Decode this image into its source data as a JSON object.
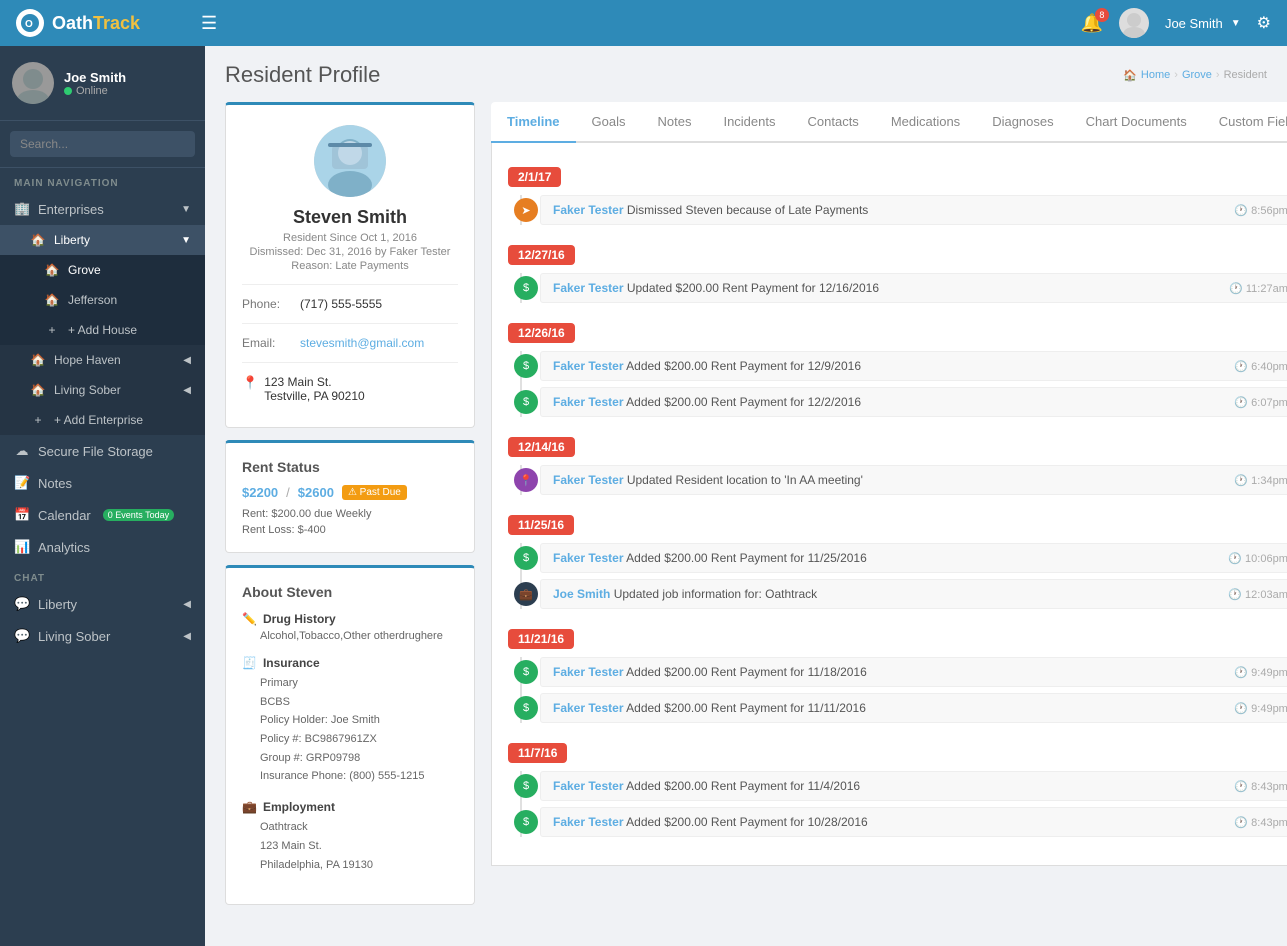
{
  "app": {
    "name": "OathTrack",
    "logo_text_1": "Oath",
    "logo_text_2": "Track"
  },
  "topnav": {
    "hamburger": "☰",
    "bell_count": "8",
    "user_name": "Joe Smith",
    "connect_icon": "⚙"
  },
  "sidebar": {
    "user": {
      "name": "Joe Smith",
      "status": "Online"
    },
    "search_placeholder": "Search...",
    "nav_label": "MAIN NAVIGATION",
    "enterprises_label": "Enterprises",
    "liberty_label": "Liberty",
    "grove_label": "Grove",
    "jefferson_label": "Jefferson",
    "add_house_label": "+ Add House",
    "hope_haven_label": "Hope Haven",
    "living_sober_label": "Living Sober",
    "add_enterprise_label": "+ Add Enterprise",
    "secure_file_storage_label": "Secure File Storage",
    "notes_label": "Notes",
    "calendar_label": "Calendar",
    "calendar_badge": "0 Events Today",
    "analytics_label": "Analytics",
    "chat_label": "Chat",
    "chat_liberty_label": "Liberty",
    "chat_living_sober_label": "Living Sober"
  },
  "page": {
    "title": "Resident Profile",
    "breadcrumb": {
      "home": "Home",
      "enterprise": "Grove",
      "current": "Resident"
    }
  },
  "profile": {
    "name": "Steven Smith",
    "resident_since": "Resident Since Oct 1, 2016",
    "dismissed": "Dismissed: Dec 31, 2016 by Faker Tester",
    "reason": "Reason: Late Payments",
    "phone_label": "Phone:",
    "phone": "(717) 555-5555",
    "email_label": "Email:",
    "email": "stevesmith@gmail.com",
    "address_line1": "123 Main St.",
    "address_line2": "Testville, PA 90210"
  },
  "rent": {
    "title": "Rent Status",
    "amount_paid": "$2200",
    "amount_total": "$2600",
    "past_due_label": "⚠ Past Due",
    "rent_detail": "Rent: $200.00 due Weekly",
    "rent_loss": "Rent Loss: $-400"
  },
  "about": {
    "title": "About Steven",
    "drug_history_title": "Drug History",
    "drug_history_content": "Alcohol,Tobacco,Other otherdrughere",
    "insurance_title": "Insurance",
    "insurance_content": {
      "type": "Primary",
      "company": "BCBS",
      "policy_holder": "Policy Holder: Joe Smith",
      "policy_num": "Policy #: BC9867961ZX",
      "group": "Group #: GRP09798",
      "phone": "Insurance Phone: (800) 555-1215"
    },
    "employment_title": "Employment",
    "employment_content": {
      "company": "Oathtrack",
      "address1": "123 Main St.",
      "address2": "Philadelphia, PA 19130"
    }
  },
  "tabs": [
    {
      "id": "timeline",
      "label": "Timeline",
      "active": true
    },
    {
      "id": "goals",
      "label": "Goals"
    },
    {
      "id": "notes",
      "label": "Notes"
    },
    {
      "id": "incidents",
      "label": "Incidents"
    },
    {
      "id": "contacts",
      "label": "Contacts"
    },
    {
      "id": "medications",
      "label": "Medications"
    },
    {
      "id": "diagnoses",
      "label": "Diagnoses"
    },
    {
      "id": "chart-documents",
      "label": "Chart Documents"
    },
    {
      "id": "custom-fields",
      "label": "Custom Fields"
    }
  ],
  "timeline": [
    {
      "date": "2/1/17",
      "items": [
        {
          "dot": "orange",
          "icon": "➤",
          "actor": "Faker Tester",
          "text": " Dismissed Steven because of Late Payments",
          "time": "8:56pm"
        }
      ]
    },
    {
      "date": "12/27/16",
      "items": [
        {
          "dot": "green",
          "icon": "$",
          "actor": "Faker Tester",
          "text": " Updated $200.00 Rent Payment for 12/16/2016",
          "time": "11:27am"
        }
      ]
    },
    {
      "date": "12/26/16",
      "items": [
        {
          "dot": "green",
          "icon": "$",
          "actor": "Faker Tester",
          "text": " Added $200.00 Rent Payment for 12/9/2016",
          "time": "6:40pm"
        },
        {
          "dot": "green",
          "icon": "$",
          "actor": "Faker Tester",
          "text": " Added $200.00 Rent Payment for 12/2/2016",
          "time": "6:07pm"
        }
      ]
    },
    {
      "date": "12/14/16",
      "items": [
        {
          "dot": "purple",
          "icon": "📍",
          "actor": "Faker Tester",
          "text": " Updated Resident location to 'In AA meeting'",
          "time": "1:34pm"
        }
      ]
    },
    {
      "date": "11/25/16",
      "items": [
        {
          "dot": "green",
          "icon": "$",
          "actor": "Faker Tester",
          "text": " Added $200.00 Rent Payment for 11/25/2016",
          "time": "10:06pm"
        },
        {
          "dot": "dark",
          "icon": "💼",
          "actor": "Joe Smith",
          "text": " Updated job information for: Oathtrack",
          "time": "12:03am"
        }
      ]
    },
    {
      "date": "11/21/16",
      "items": [
        {
          "dot": "green",
          "icon": "$",
          "actor": "Faker Tester",
          "text": " Added $200.00 Rent Payment for 11/18/2016",
          "time": "9:49pm"
        },
        {
          "dot": "green",
          "icon": "$",
          "actor": "Faker Tester",
          "text": " Added $200.00 Rent Payment for 11/11/2016",
          "time": "9:49pm"
        }
      ]
    },
    {
      "date": "11/7/16",
      "items": [
        {
          "dot": "green",
          "icon": "$",
          "actor": "Faker Tester",
          "text": " Added $200.00 Rent Payment for 11/4/2016",
          "time": "8:43pm"
        },
        {
          "dot": "green",
          "icon": "$",
          "actor": "Faker Tester",
          "text": " Added $200.00 Rent Payment for 10/28/2016",
          "time": "8:43pm"
        }
      ]
    }
  ]
}
